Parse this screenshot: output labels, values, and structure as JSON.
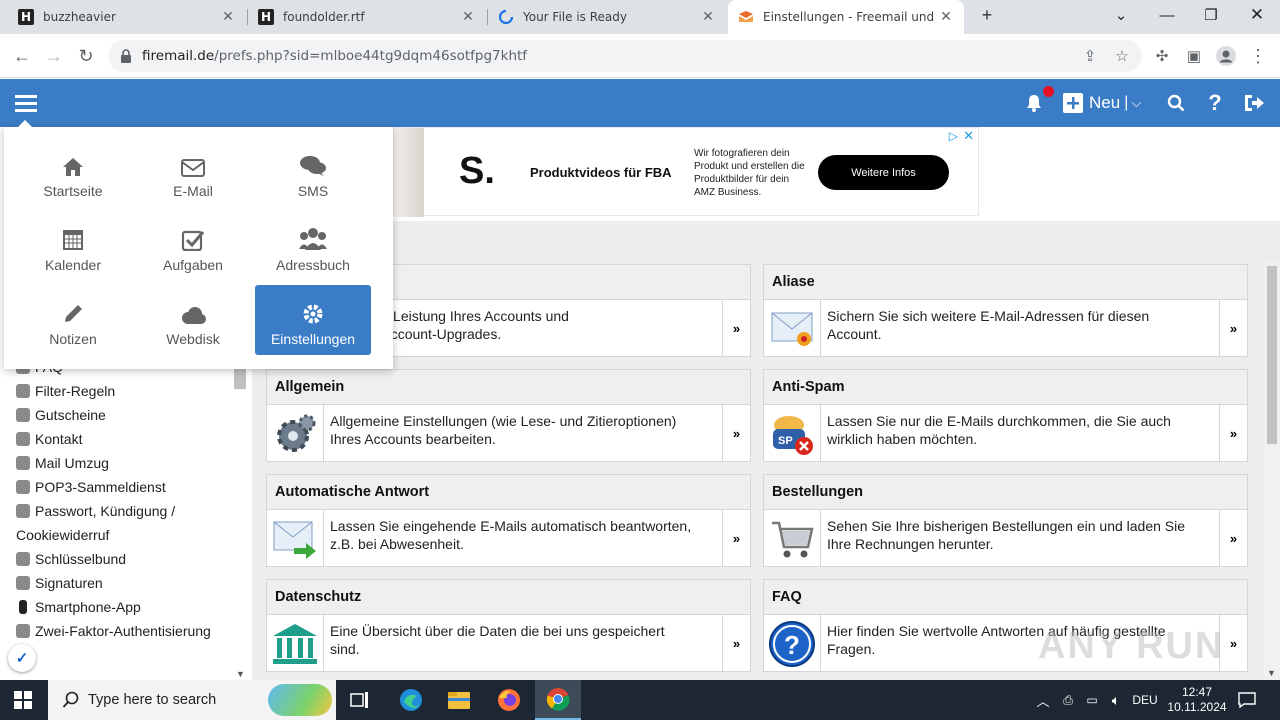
{
  "browser": {
    "tabs": [
      {
        "title": "buzzheavier",
        "icon": "h-logo-icon"
      },
      {
        "title": "foundolder.rtf",
        "icon": "h-logo-icon"
      },
      {
        "title": "Your File is Ready",
        "icon": "loading-icon"
      },
      {
        "title": "Einstellungen - Freemail und ser",
        "icon": "freemail-logo-icon",
        "active": true
      }
    ],
    "url_host": "firemail.de",
    "url_path": "/prefs.php?sid=mlboe44tg9dqm46sotfpg7khtf"
  },
  "header": {
    "new_label": "Neu",
    "notification_badge_color": "#e81123",
    "bar_color": "#3a7cc6"
  },
  "ad": {
    "logo": "S.",
    "headline": "Produktvideos für FBA",
    "body": "Wir fotografieren dein Produkt und erstellen die Produktbilder für dein AMZ Business.",
    "cta": "Weitere Infos"
  },
  "app_menu": [
    {
      "label": "Startseite",
      "icon": "home-icon"
    },
    {
      "label": "E-Mail",
      "icon": "envelope-icon"
    },
    {
      "label": "SMS",
      "icon": "chat-icon"
    },
    {
      "label": "Kalender",
      "icon": "calendar-icon"
    },
    {
      "label": "Aufgaben",
      "icon": "checkbox-icon"
    },
    {
      "label": "Adressbuch",
      "icon": "group-icon"
    },
    {
      "label": "Notizen",
      "icon": "pencil-icon"
    },
    {
      "label": "Webdisk",
      "icon": "cloud-icon"
    },
    {
      "label": "Einstellungen",
      "icon": "gear-icon",
      "selected": true
    }
  ],
  "sidebar": {
    "items": [
      "FAQ",
      "Filter-Regeln",
      "Gutscheine",
      "Kontakt",
      "Mail Umzug",
      "POP3-Sammeldienst",
      "Passwort, Kündigung /",
      "Cookiewiderruf",
      "Schlüsselbund",
      "Signaturen",
      "Smartphone-App",
      "Zwei-Faktor-Authentisierung"
    ]
  },
  "cards": [
    {
      "title": "",
      "text1": "rn Sie die Leistung Ihres Accounts und",
      "text2": "Sie Ihre Account-Upgrades.",
      "icon": "upgrade-icon"
    },
    {
      "title": "Aliase",
      "text1": "Sichern Sie sich weitere E-Mail-Adressen für diesen",
      "text2": "Account.",
      "icon": "mail-alias-icon"
    },
    {
      "title": "Allgemein",
      "text1": "Allgemeine Einstellungen (wie Lese- und Zitieroptionen)",
      "text2": "Ihres Accounts bearbeiten.",
      "icon": "gears-icon"
    },
    {
      "title": "Anti-Spam",
      "text1": "Lassen Sie nur die E-Mails durchkommen, die Sie auch",
      "text2": "wirklich haben möchten.",
      "icon": "spam-icon"
    },
    {
      "title": "Automatische Antwort",
      "text1": "Lassen Sie eingehende E-Mails automatisch beantworten,",
      "text2": "z.B. bei Abwesenheit.",
      "icon": "auto-reply-icon"
    },
    {
      "title": "Bestellungen",
      "text1": "Sehen Sie Ihre bisherigen Bestellungen ein und laden Sie",
      "text2": "Ihre Rechnungen herunter.",
      "icon": "cart-icon"
    },
    {
      "title": "Datenschutz",
      "text1": "Eine Übersicht über die Daten die bei uns gespeichert",
      "text2": "sind.",
      "icon": "bank-icon"
    },
    {
      "title": "FAQ",
      "text1": "Hier finden Sie wertvolle Antworten auf häufig gestellte",
      "text2": "Fragen.",
      "icon": "help-icon"
    }
  ],
  "card_arrow": "»",
  "taskbar": {
    "search_placeholder": "Type here to search",
    "language": "DEU",
    "time": "12:47",
    "date": "10.11.2024"
  },
  "watermark": "ANY RUN"
}
